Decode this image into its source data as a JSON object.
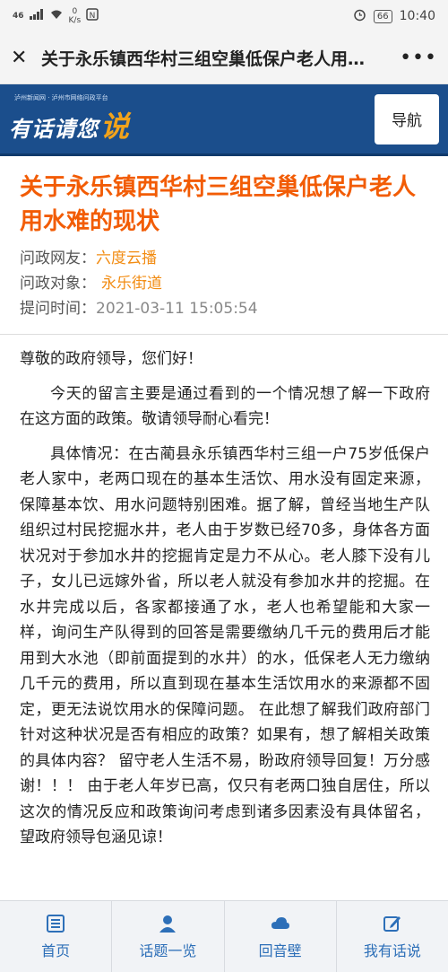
{
  "status_bar": {
    "signal": "46",
    "speed": "0\nK/s",
    "battery": "66",
    "time": "10:40"
  },
  "title_bar": {
    "title": "关于永乐镇西华村三组空巢低保户老人用…",
    "more": "•••"
  },
  "site": {
    "logo_sub": "泸州新闻网 · 泸州市网络问政平台",
    "logo_text": "有话请您",
    "logo_accent": "说",
    "nav_label": "导航"
  },
  "article": {
    "title": "关于永乐镇西华村三组空巢低保户老人用水难的现状",
    "meta": [
      {
        "label": "问政网友：",
        "value": "六度云播"
      },
      {
        "label": "问政对象：",
        "value": "永乐街道"
      },
      {
        "label": "提问时间：",
        "value": "2021-03-11 15:05:54"
      }
    ],
    "paragraphs": [
      "尊敬的政府领导，您们好！",
      "今天的留言主要是通过看到的一个情况想了解一下政府在这方面的政策。敬请领导耐心看完！",
      "具体情况：在古蔺县永乐镇西华村三组一户75岁低保户老人家中，老两口现在的基本生活饮、用水没有固定来源，保障基本饮、用水问题特别困难。据了解，曾经当地生产队组织过村民挖掘水井，老人由于岁数已经70多，身体各方面状况对于参加水井的挖掘肯定是力不从心。老人膝下没有儿子，女儿已远嫁外省，所以老人就没有参加水井的挖掘。在水井完成以后，各家都接通了水，老人也希望能和大家一样，询问生产队得到的回答是需要缴纳几千元的费用后才能用到大水池（即前面提到的水井）的水，低保老人无力缴纳几千元的费用，所以直到现在基本生活饮用水的来源都不固定，更无法说饮用水的保障问题。 在此想了解我们政府部门针对这种状况是否有相应的政策？如果有，想了解相关政策的具体内容？ 留守老人生活不易，盼政府领导回复！万分感谢！！！ 由于老人年岁已高，仅只有老两口独自居住，所以这次的情况反应和政策询问考虑到诸多因素没有具体留名，望政府领导包涵见谅！"
    ]
  },
  "bottom_nav": [
    {
      "label": "首页",
      "icon": "home-list-icon"
    },
    {
      "label": "话题一览",
      "icon": "user-icon"
    },
    {
      "label": "回音壁",
      "icon": "cloud-icon"
    },
    {
      "label": "我有话说",
      "icon": "edit-icon"
    }
  ]
}
